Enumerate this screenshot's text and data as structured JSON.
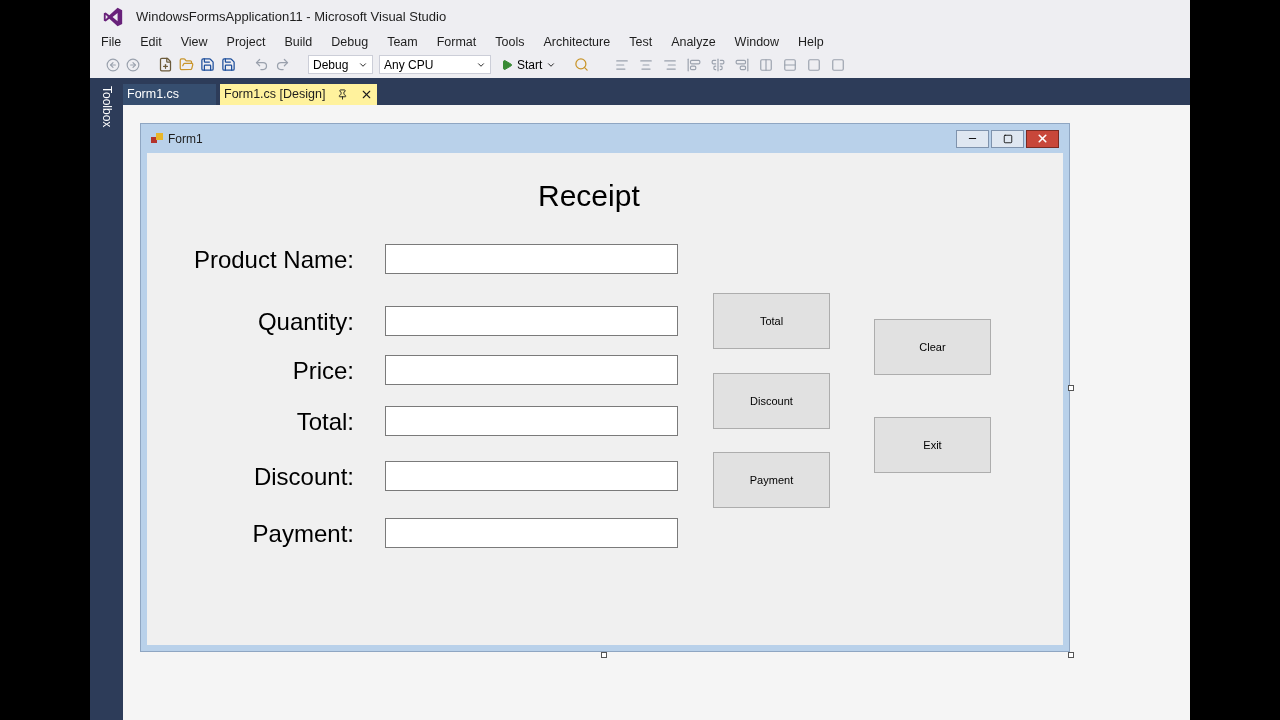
{
  "window": {
    "title": "WindowsFormsApplication11 - Microsoft Visual Studio"
  },
  "menu": [
    "File",
    "Edit",
    "View",
    "Project",
    "Build",
    "Debug",
    "Team",
    "Format",
    "Tools",
    "Architecture",
    "Test",
    "Analyze",
    "Window",
    "Help"
  ],
  "toolbar": {
    "configuration": "Debug",
    "platform": "Any CPU",
    "start": "Start"
  },
  "toolbox": "Toolbox",
  "tabs": [
    {
      "label": "Form1.cs",
      "selected": false
    },
    {
      "label": "Form1.cs [Design]",
      "selected": true
    }
  ],
  "form": {
    "title": "Form1",
    "heading": "Receipt",
    "fields": [
      {
        "label": "Product Name:"
      },
      {
        "label": "Quantity:"
      },
      {
        "label": "Price:"
      },
      {
        "label": "Total:"
      },
      {
        "label": "Discount:"
      },
      {
        "label": "Payment:"
      }
    ],
    "buttons": [
      "Total",
      "Discount",
      "Payment",
      "Clear",
      "Exit"
    ]
  }
}
